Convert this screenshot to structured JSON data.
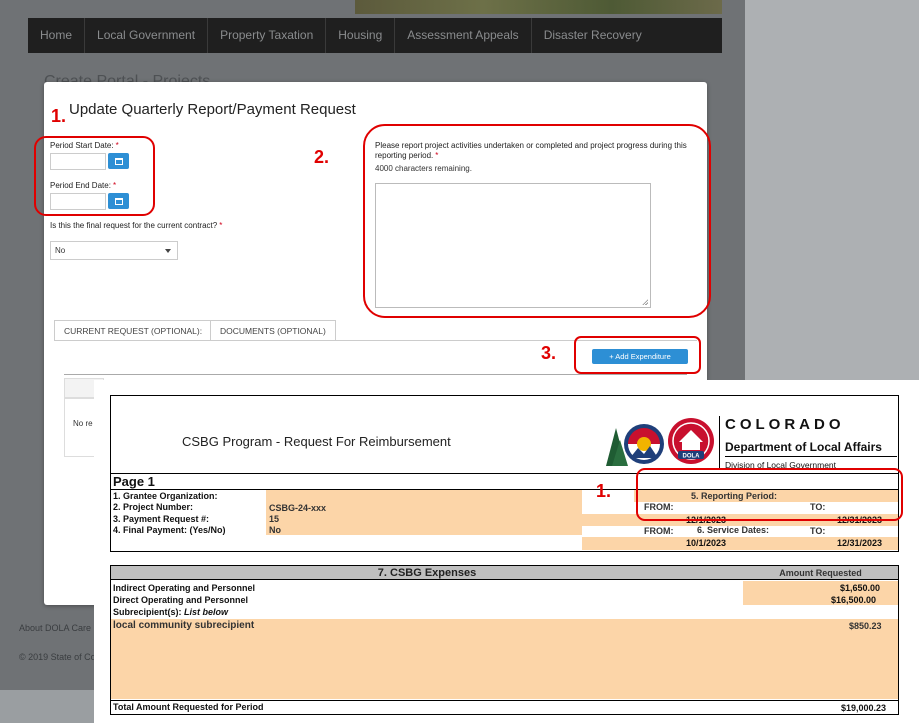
{
  "nav": {
    "items": [
      "Home",
      "Local Government",
      "Property Taxation",
      "Housing",
      "Assessment Appeals",
      "Disaster Recovery"
    ]
  },
  "page": {
    "heading": "Create Portal - Projects",
    "footer_links": "About DOLA  Care",
    "footer_copy": "© 2019 State of Co"
  },
  "modal": {
    "title": "Update Quarterly Report/Payment Request",
    "period_start_label": "Period Start Date:",
    "period_end_label": "Period End Date:",
    "required_mark": "*",
    "final_request_label": "Is this the final request for the current contract?",
    "final_request_value": "No",
    "activities_prompt": "Please report project activities undertaken or completed and project progress during this reporting period.",
    "chars_remaining": "4000 characters remaining.",
    "tabs": [
      "CURRENT REQUEST (OPTIONAL):",
      "DOCUMENTS (OPTIONAL)"
    ],
    "add_expenditure_label": "+ Add Expenditure",
    "grid_empty_text": "No re"
  },
  "annotations": {
    "num1": "1.",
    "num2": "2.",
    "num3": "3.",
    "form_num1": "1."
  },
  "form": {
    "title": "CSBG Program -  Request For Reimbursement",
    "brand_colorado": "COLORADO",
    "brand_dept": "Department of Local Affairs",
    "brand_division": "Division of Local Government",
    "seal_text": "DOLA",
    "page_label": "Page 1",
    "fields": {
      "grantee_label": "1. Grantee Organization:",
      "project_label": "2. Project Number:",
      "project_value": "CSBG-24-xxx",
      "payment_label": "3. Payment Request #:",
      "payment_value": "15",
      "final_label": "4. Final Payment: (Yes/No)",
      "final_value": "No"
    },
    "reporting_period_label": "5. Reporting Period:",
    "service_dates_label": "6. Service Dates:",
    "from_label": "FROM:",
    "to_label": "TO:",
    "reporting_from": "12/1/2023",
    "reporting_to": "12/31/2023",
    "service_from": "10/1/2023",
    "service_to": "12/31/2023",
    "expenses_title": "7. CSBG Expenses",
    "amount_header": "Amount Requested",
    "expenses": [
      {
        "label": "Indirect Operating and Personnel",
        "amount": "$1,650.00"
      },
      {
        "label": "Direct Operating and Personnel",
        "amount": "$16,500.00"
      }
    ],
    "subrecipient_label": "Subrecipient(s):",
    "subrecipient_note": "List below",
    "subrecipient_name": "local community subrecipient",
    "subrecipient_amount": "$850.23",
    "total_label": "Total Amount Requested for Period",
    "total_amount": "$19,000.23"
  },
  "colors": {
    "annotation_red": "#e00000",
    "button_blue": "#2d8fd5",
    "form_tan": "#fcd5a8"
  }
}
